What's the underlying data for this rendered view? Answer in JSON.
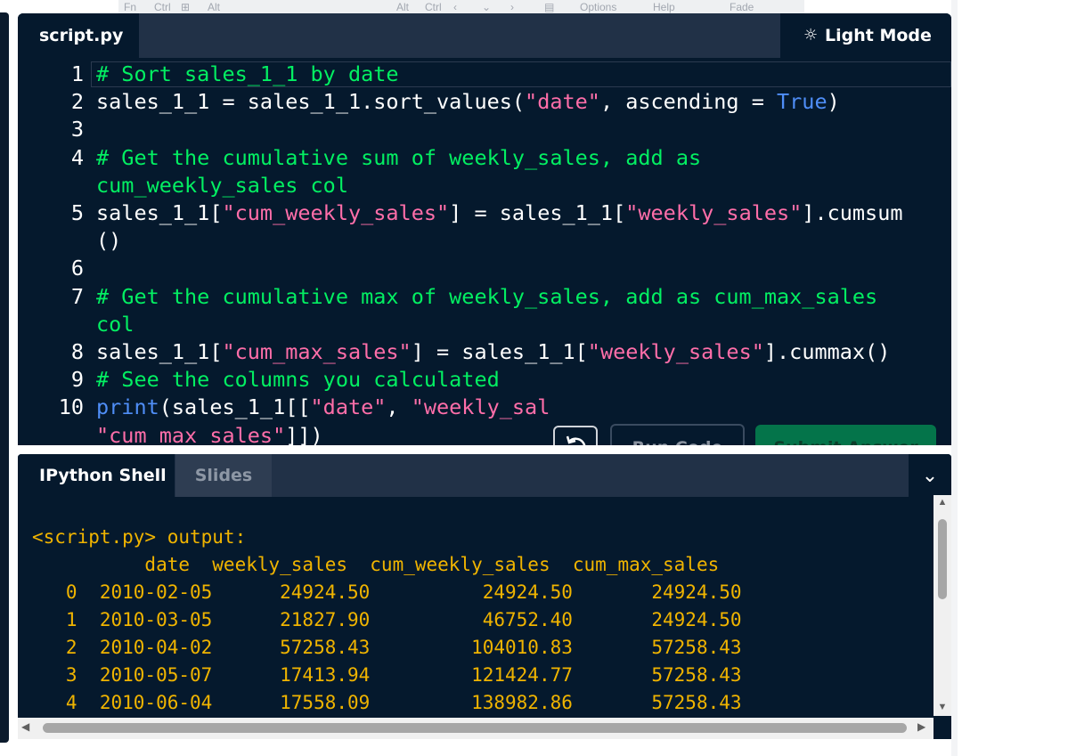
{
  "os_toolbar": {
    "items": [
      "Fn",
      "Ctrl",
      "Alt",
      "Alt",
      "Ctrl",
      "Options",
      "Help",
      "Fade"
    ]
  },
  "editor": {
    "tab_label": "script.py",
    "light_mode_label": "Light Mode",
    "lines": [
      {
        "n": "1",
        "parts": [
          {
            "t": "# Sort sales_1_1 by date",
            "c": "cm"
          }
        ]
      },
      {
        "n": "2",
        "parts": [
          {
            "t": "sales_1_1 = sales_1_1.sort_values(",
            "c": ""
          },
          {
            "t": "\"date\"",
            "c": "str"
          },
          {
            "t": ", ascending = ",
            "c": ""
          },
          {
            "t": "True",
            "c": "kw2"
          },
          {
            "t": ")",
            "c": ""
          }
        ]
      },
      {
        "n": "3",
        "parts": []
      },
      {
        "n": "4",
        "parts": [
          {
            "t": "# Get the cumulative sum of weekly_sales, add as",
            "c": "cm"
          }
        ]
      },
      {
        "n": "",
        "parts": [
          {
            "t": "cum_weekly_sales col",
            "c": "cm"
          }
        ]
      },
      {
        "n": "5",
        "parts": [
          {
            "t": "sales_1_1[",
            "c": ""
          },
          {
            "t": "\"cum_weekly_sales\"",
            "c": "str"
          },
          {
            "t": "] = sales_1_1[",
            "c": ""
          },
          {
            "t": "\"weekly_sales\"",
            "c": "str"
          },
          {
            "t": "].cumsum",
            "c": ""
          }
        ]
      },
      {
        "n": "",
        "parts": [
          {
            "t": "()",
            "c": ""
          }
        ]
      },
      {
        "n": "6",
        "parts": []
      },
      {
        "n": "7",
        "parts": [
          {
            "t": "# Get the cumulative max of weekly_sales, add as cum_max_sales",
            "c": "cm"
          }
        ]
      },
      {
        "n": "",
        "parts": [
          {
            "t": "col",
            "c": "cm"
          }
        ]
      },
      {
        "n": "8",
        "parts": [
          {
            "t": "sales_1_1[",
            "c": ""
          },
          {
            "t": "\"cum_max_sales\"",
            "c": "str"
          },
          {
            "t": "] = sales_1_1[",
            "c": ""
          },
          {
            "t": "\"weekly_sales\"",
            "c": "str"
          },
          {
            "t": "].cummax()",
            "c": ""
          }
        ]
      },
      {
        "n": "9",
        "parts": [
          {
            "t": "# See the columns you calculated",
            "c": "cm"
          }
        ]
      },
      {
        "n": "10",
        "parts": [
          {
            "t": "print",
            "c": "kw2"
          },
          {
            "t": "(sales_1_1[[",
            "c": ""
          },
          {
            "t": "\"date\"",
            "c": "str"
          },
          {
            "t": ", ",
            "c": ""
          },
          {
            "t": "\"weekly_sal",
            "c": "str"
          }
        ]
      },
      {
        "n": "",
        "parts": [
          {
            "t": "\"cum_max_sales\"",
            "c": "str"
          },
          {
            "t": "]])",
            "c": ""
          }
        ]
      }
    ],
    "run_label": "Run Code",
    "submit_label": "Submit Answer"
  },
  "shell": {
    "tab_ipython": "IPython Shell",
    "tab_slides": "Slides",
    "output_header": "<script.py> output:",
    "columns_line": "          date  weekly_sales  cum_weekly_sales  cum_max_sales",
    "rows": [
      "   0  2010-02-05      24924.50          24924.50       24924.50",
      "   1  2010-03-05      21827.90          46752.40       24924.50",
      "   2  2010-04-02      57258.43         104010.83       57258.43",
      "   3  2010-05-07      17413.94         121424.77       57258.43",
      "   4  2010-06-04      17558.09         138982.86       57258.43"
    ]
  },
  "colors": {
    "background": "#05192d",
    "comment": "#03ef62",
    "string": "#ff6ea9",
    "keyword": "#4f8ef7",
    "output": "#f0b400",
    "submit": "#04744a"
  },
  "icons": [
    "sun-icon",
    "reset-icon",
    "chevron-down-icon",
    "scroll-up-arrow-icon",
    "scroll-down-arrow-icon",
    "scroll-left-arrow-icon",
    "scroll-right-arrow-icon"
  ]
}
